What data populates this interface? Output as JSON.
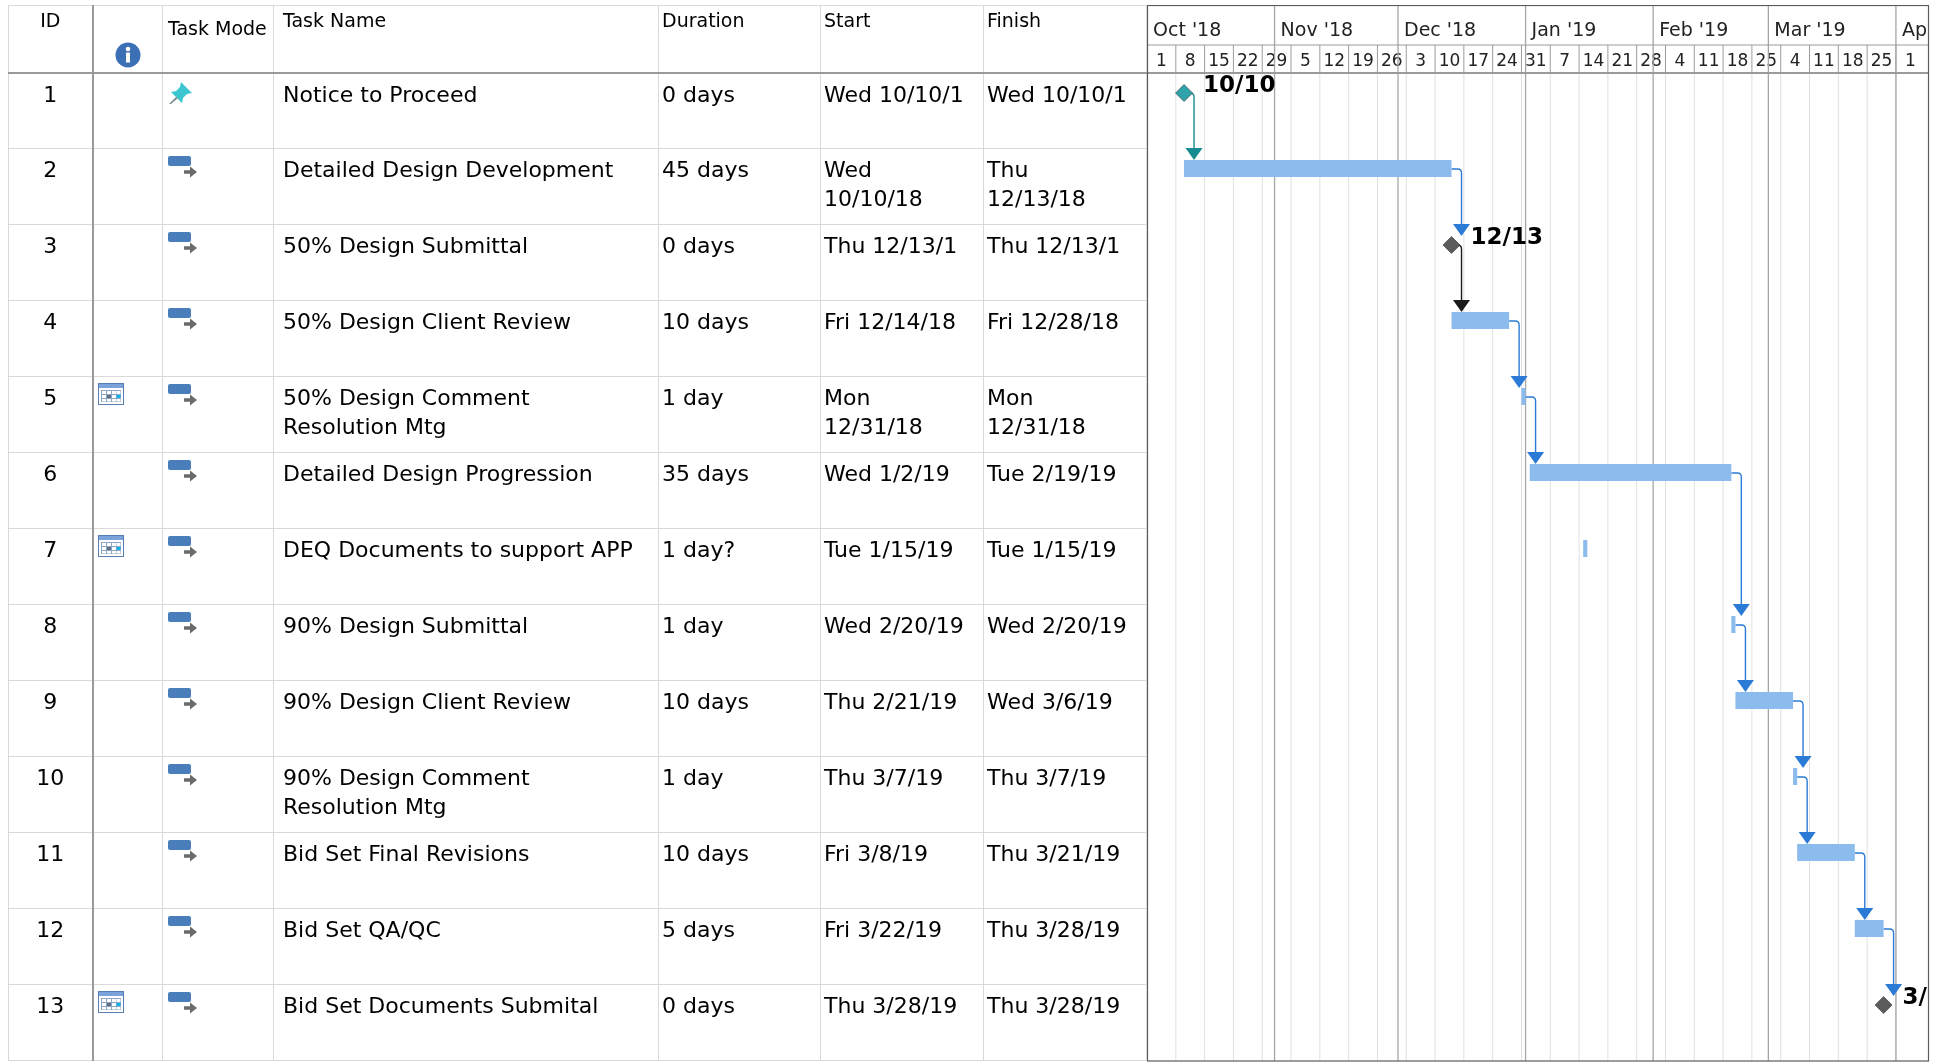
{
  "columns": [
    {
      "kind": "text",
      "label": "ID"
    },
    {
      "kind": "info"
    },
    {
      "kind": "text",
      "label": "Task Mode"
    },
    {
      "kind": "text",
      "label": "Task Name"
    },
    {
      "kind": "text",
      "label": "Duration"
    },
    {
      "kind": "text",
      "label": "Start"
    },
    {
      "kind": "text",
      "label": "Finish"
    }
  ],
  "tasks": [
    {
      "id": "1",
      "calendar": false,
      "manual": true,
      "name": "Notice to Proceed",
      "duration": "0 days",
      "start": "Wed 10/10/1",
      "finish": "Wed 10/10/1",
      "kind": "milestone",
      "bar_label": "10/10"
    },
    {
      "id": "2",
      "calendar": false,
      "manual": false,
      "name": "Detailed Design Development",
      "duration": "45 days",
      "start": "Wed 10/10/18",
      "finish": "Thu 12/13/18",
      "kind": "task"
    },
    {
      "id": "3",
      "calendar": false,
      "manual": false,
      "name": "50% Design Submittal",
      "duration": "0 days",
      "start": "Thu 12/13/1",
      "finish": "Thu 12/13/1",
      "kind": "milestone",
      "bar_label": "12/13"
    },
    {
      "id": "4",
      "calendar": false,
      "manual": false,
      "name": "50% Design Client Review",
      "duration": "10 days",
      "start": "Fri 12/14/18",
      "finish": "Fri 12/28/18",
      "kind": "task"
    },
    {
      "id": "5",
      "calendar": true,
      "manual": false,
      "name": "50% Design Comment Resolution Mtg",
      "duration": "1 day",
      "start": "Mon 12/31/18",
      "finish": "Mon 12/31/18",
      "kind": "task"
    },
    {
      "id": "6",
      "calendar": false,
      "manual": false,
      "name": "Detailed Design Progression",
      "duration": "35 days",
      "start": "Wed 1/2/19",
      "finish": "Tue 2/19/19",
      "kind": "task"
    },
    {
      "id": "7",
      "calendar": true,
      "manual": false,
      "name": "DEQ Documents to support APP",
      "duration": "1 day?",
      "start": "Tue 1/15/19",
      "finish": "Tue 1/15/19",
      "kind": "task"
    },
    {
      "id": "8",
      "calendar": false,
      "manual": false,
      "name": "90% Design Submittal",
      "duration": "1 day",
      "start": "Wed 2/20/19",
      "finish": "Wed 2/20/19",
      "kind": "task"
    },
    {
      "id": "9",
      "calendar": false,
      "manual": false,
      "name": "90% Design Client Review",
      "duration": "10 days",
      "start": "Thu 2/21/19",
      "finish": "Wed 3/6/19",
      "kind": "task"
    },
    {
      "id": "10",
      "calendar": false,
      "manual": false,
      "name": "90% Design Comment Resolution Mtg",
      "duration": "1 day",
      "start": "Thu 3/7/19",
      "finish": "Thu 3/7/19",
      "kind": "task"
    },
    {
      "id": "11",
      "calendar": false,
      "manual": false,
      "name": "Bid Set Final Revisions",
      "duration": "10 days",
      "start": "Fri 3/8/19",
      "finish": "Thu 3/21/19",
      "kind": "task"
    },
    {
      "id": "12",
      "calendar": false,
      "manual": false,
      "name": "Bid Set QA/QC",
      "duration": "5 days",
      "start": "Fri 3/22/19",
      "finish": "Thu 3/28/19",
      "kind": "task"
    },
    {
      "id": "13",
      "calendar": true,
      "manual": false,
      "name": "Bid Set Documents Submital",
      "duration": "0 days",
      "start": "Thu 3/28/19",
      "finish": "Thu 3/28/19",
      "kind": "milestone",
      "bar_label": "3/"
    }
  ],
  "timescale": {
    "months": [
      "Oct '18",
      "Nov '18",
      "Dec '18",
      "Jan '19",
      "Feb '19",
      "Mar '19",
      "Ap"
    ],
    "weeks": [
      "1",
      "8",
      "15",
      "22",
      "29",
      "5",
      "12",
      "19",
      "26",
      "3",
      "10",
      "17",
      "24",
      "31",
      "7",
      "14",
      "21",
      "28",
      "4",
      "11",
      "18",
      "25",
      "4",
      "11",
      "18",
      "25",
      "1"
    ]
  }
}
